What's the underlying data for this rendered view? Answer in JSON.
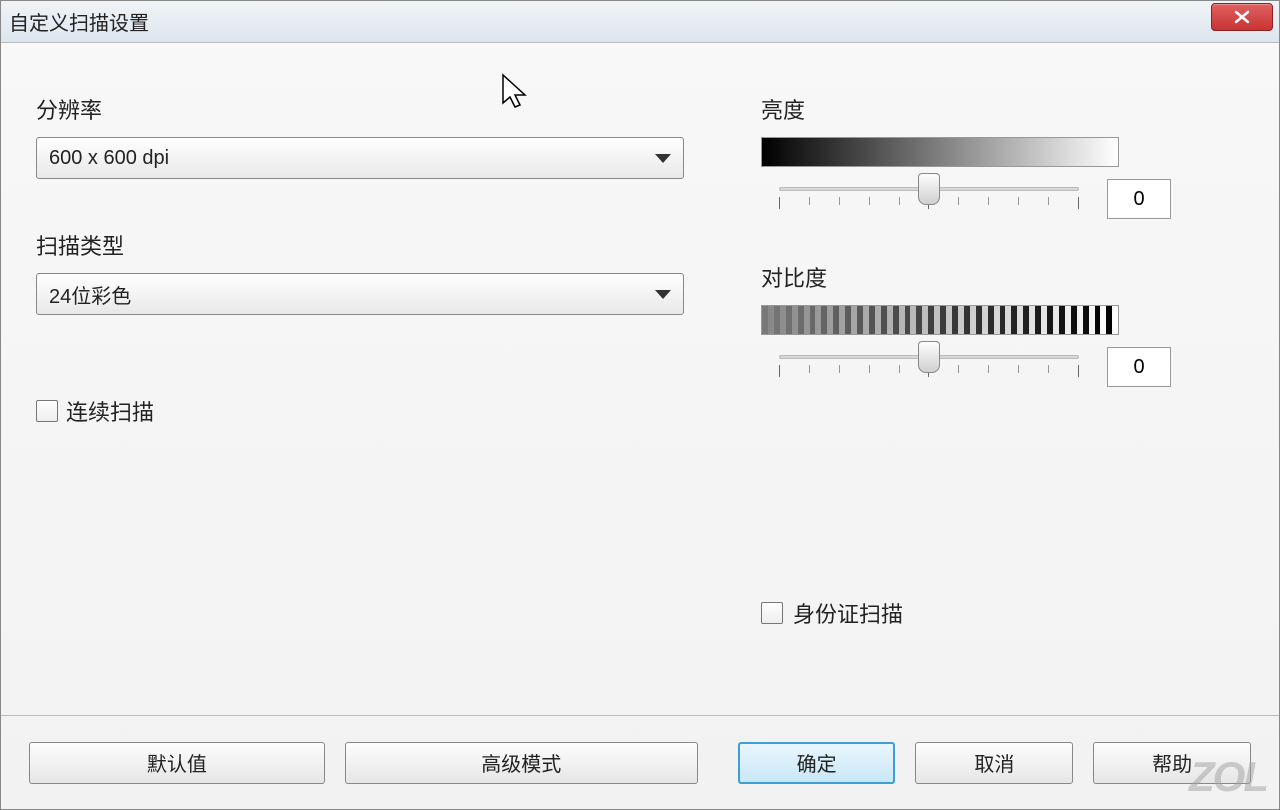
{
  "window": {
    "title": "自定义扫描设置"
  },
  "resolution": {
    "label": "分辨率",
    "value": "600 x 600 dpi"
  },
  "scanType": {
    "label": "扫描类型",
    "value": "24位彩色"
  },
  "continuousScan": {
    "label": "连续扫描"
  },
  "brightness": {
    "label": "亮度",
    "value": "0"
  },
  "contrast": {
    "label": "对比度",
    "value": "0"
  },
  "idScan": {
    "label": "身份证扫描"
  },
  "buttons": {
    "default": "默认值",
    "advanced": "高级模式",
    "ok": "确定",
    "cancel": "取消",
    "help": "帮助"
  },
  "watermark": "ZOL"
}
